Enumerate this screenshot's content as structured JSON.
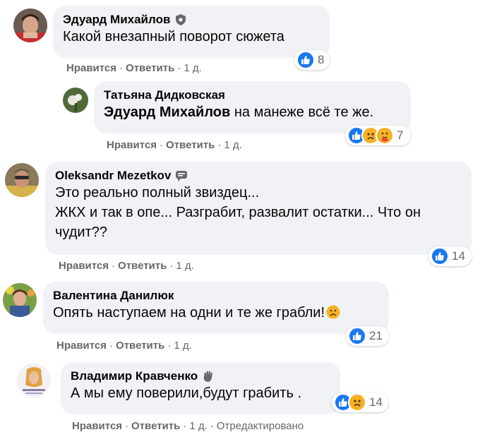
{
  "comments": [
    {
      "author": "Эдуард Михайлов",
      "text": "Какой внезапный поворот сюжета",
      "reactions": {
        "types": [
          "like"
        ],
        "count": "8"
      },
      "actions": {
        "like": "Нравится",
        "reply": "Ответить",
        "time": "1 д."
      },
      "badge": "shield-icon"
    },
    {
      "author": "Татьяна Дидковская",
      "mention": "Эдуард Михайлов",
      "text": " на манеже всё те же.",
      "reactions": {
        "types": [
          "like",
          "sad",
          "care"
        ],
        "count": "7"
      },
      "actions": {
        "like": "Нравится",
        "reply": "Ответить",
        "time": "1 д."
      }
    },
    {
      "author": "Oleksandr Mezetkov",
      "text_lines": [
        "Это реально полный звиздец...",
        "ЖКХ и так в опе... Разграбит, развалит остатки... Что он",
        "чудит??"
      ],
      "reactions": {
        "types": [
          "like"
        ],
        "count": "14"
      },
      "actions": {
        "like": "Нравится",
        "reply": "Ответить",
        "time": "1 д."
      },
      "badge": "chat-bubble-icon"
    },
    {
      "author": "Валентина Данилюк",
      "text": "Опять наступаем на одни и те же грабли!",
      "reactions": {
        "types": [
          "like"
        ],
        "count": "21"
      },
      "actions": {
        "like": "Нравится",
        "reply": "Ответить",
        "time": "1 д."
      }
    },
    {
      "author": "Владимир Кравченко",
      "text": "А мы ему поверили,будут грабить .",
      "reactions": {
        "types": [
          "like",
          "sad"
        ],
        "count": "14"
      },
      "actions": {
        "like": "Нравится",
        "reply": "Ответить",
        "time": "1 д.",
        "edited": "Отредактировано"
      },
      "badge": "waving-hand-icon"
    }
  ],
  "separator": "·",
  "colors": {
    "bubble": "#f0f2f5",
    "like": "#1877f2",
    "meta": "#65676b",
    "text": "#050505"
  }
}
